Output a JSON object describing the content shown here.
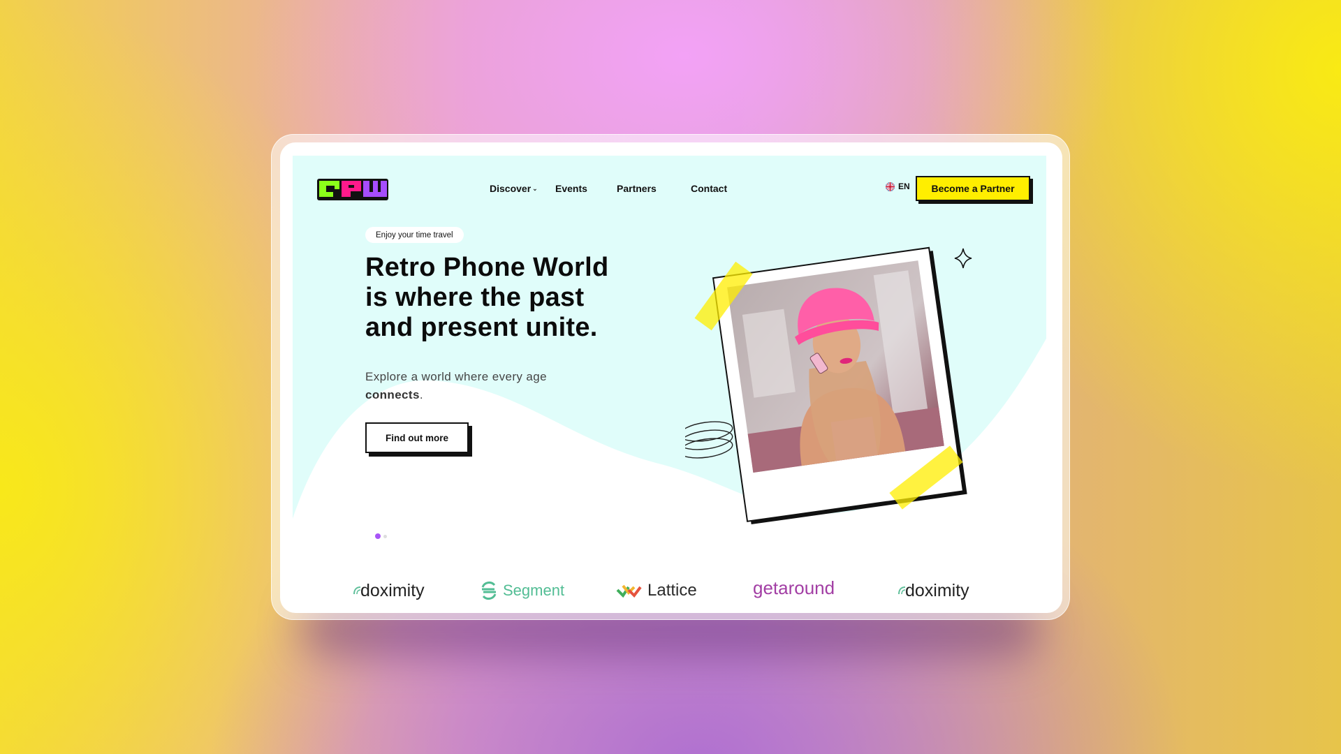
{
  "site": {
    "logo_text": "RPW",
    "logo_colors": [
      "#8cff1a",
      "#ff1a8c",
      "#a64dff"
    ]
  },
  "nav": {
    "items": [
      {
        "label": "Discover",
        "has_dropdown": true
      },
      {
        "label": "Events",
        "has_dropdown": false
      },
      {
        "label": "Partners",
        "has_dropdown": false
      },
      {
        "label": "Contact",
        "has_dropdown": false
      }
    ],
    "dropdown_icon": "chevron-down-icon",
    "language": {
      "icon": "uk-flag-icon",
      "label": "EN"
    },
    "cta_label": "Become a Partner"
  },
  "hero": {
    "tagline": "Enjoy your time travel",
    "headline_lines": [
      "Retro Phone World",
      "is where the past",
      "and present unite."
    ],
    "subtext_prefix": "Explore a world where every age",
    "subtext_bold": "connects",
    "subtext_suffix": ".",
    "cta_label": "Find out more",
    "image_alt": "Woman in pink bucket hat talking on a retro flip phone",
    "carousel": {
      "total": 2,
      "active": 1
    }
  },
  "brands": [
    {
      "name": "doximity",
      "color": "#222222",
      "accent": "#5fbf9a"
    },
    {
      "name": "Segment",
      "color": "#52bd94",
      "accent": "#52bd94"
    },
    {
      "name": "Lattice",
      "color": "#2b2b2b",
      "accent": "#f2b630"
    },
    {
      "name": "getaround",
      "color": "#a23ea4",
      "accent": "#a23ea4"
    },
    {
      "name": "doximity",
      "color": "#222222",
      "accent": "#5fbf9a"
    }
  ],
  "colors": {
    "hero_bg": "#e0fdfa",
    "cta_yellow": "#ffee00",
    "accent_purple": "#a855f7"
  }
}
